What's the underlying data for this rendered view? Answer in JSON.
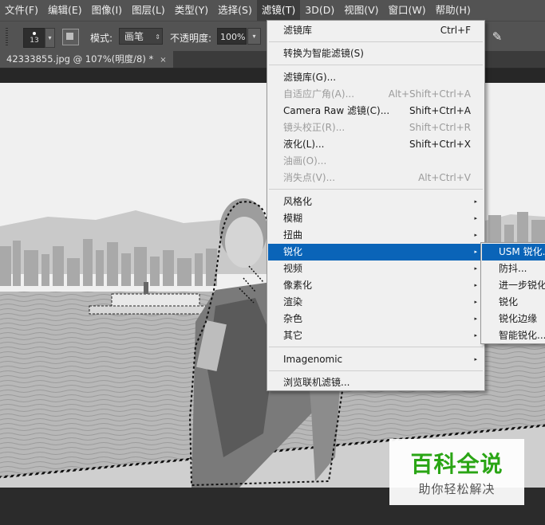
{
  "menubar": {
    "items": [
      "文件(F)",
      "编辑(E)",
      "图像(I)",
      "图层(L)",
      "类型(Y)",
      "选择(S)",
      "滤镜(T)",
      "3D(D)",
      "视图(V)",
      "窗口(W)",
      "帮助(H)"
    ],
    "active_index": 6
  },
  "options": {
    "brush_size": "13",
    "mode_label": "模式:",
    "mode_value": "画笔",
    "opacity_label": "不透明度:",
    "opacity_value": "100%"
  },
  "document": {
    "tab_title": "42333855.jpg @ 107%(明度/8) *",
    "close_glyph": "×"
  },
  "filter_menu": {
    "items": [
      {
        "label": "滤镜库",
        "shortcut": "Ctrl+F",
        "disabled": false,
        "submenu": false
      },
      {
        "label": "转换为智能滤镜(S)",
        "shortcut": "",
        "disabled": false,
        "submenu": false
      },
      {
        "label": "滤镜库(G)...",
        "shortcut": "",
        "disabled": false,
        "submenu": false
      },
      {
        "label": "自适应广角(A)...",
        "shortcut": "Alt+Shift+Ctrl+A",
        "disabled": true,
        "submenu": false
      },
      {
        "label": "Camera Raw 滤镜(C)...",
        "shortcut": "Shift+Ctrl+A",
        "disabled": false,
        "submenu": false
      },
      {
        "label": "镜头校正(R)...",
        "shortcut": "Shift+Ctrl+R",
        "disabled": true,
        "submenu": false
      },
      {
        "label": "液化(L)...",
        "shortcut": "Shift+Ctrl+X",
        "disabled": false,
        "submenu": false
      },
      {
        "label": "油画(O)...",
        "shortcut": "",
        "disabled": true,
        "submenu": false
      },
      {
        "label": "消失点(V)...",
        "shortcut": "Alt+Ctrl+V",
        "disabled": true,
        "submenu": false
      },
      {
        "label": "风格化",
        "shortcut": "",
        "disabled": false,
        "submenu": true
      },
      {
        "label": "模糊",
        "shortcut": "",
        "disabled": false,
        "submenu": true
      },
      {
        "label": "扭曲",
        "shortcut": "",
        "disabled": false,
        "submenu": true
      },
      {
        "label": "锐化",
        "shortcut": "",
        "disabled": false,
        "submenu": true,
        "highlighted": true
      },
      {
        "label": "视频",
        "shortcut": "",
        "disabled": false,
        "submenu": true
      },
      {
        "label": "像素化",
        "shortcut": "",
        "disabled": false,
        "submenu": true
      },
      {
        "label": "渲染",
        "shortcut": "",
        "disabled": false,
        "submenu": true
      },
      {
        "label": "杂色",
        "shortcut": "",
        "disabled": false,
        "submenu": true
      },
      {
        "label": "其它",
        "shortcut": "",
        "disabled": false,
        "submenu": true
      },
      {
        "label": "Imagenomic",
        "shortcut": "",
        "disabled": false,
        "submenu": true
      },
      {
        "label": "浏览联机滤镜...",
        "shortcut": "",
        "disabled": false,
        "submenu": false
      }
    ]
  },
  "sharpen_submenu": {
    "items": [
      "USM 锐化...",
      "防抖...",
      "进一步锐化",
      "锐化",
      "锐化边缘",
      "智能锐化..."
    ],
    "highlighted_index": 0
  },
  "watermark": {
    "title": "百科全说",
    "subtitle": "助你轻松解决"
  },
  "icons": {
    "submenu_arrow": "▸",
    "dropdown_arrow": "▾",
    "stepper_arrow": "⇕",
    "pen_icon": "✎"
  },
  "colors": {
    "menubar_bg": "#535353",
    "menu_highlight": "#0a64b8",
    "watermark_green": "#2aa515"
  }
}
